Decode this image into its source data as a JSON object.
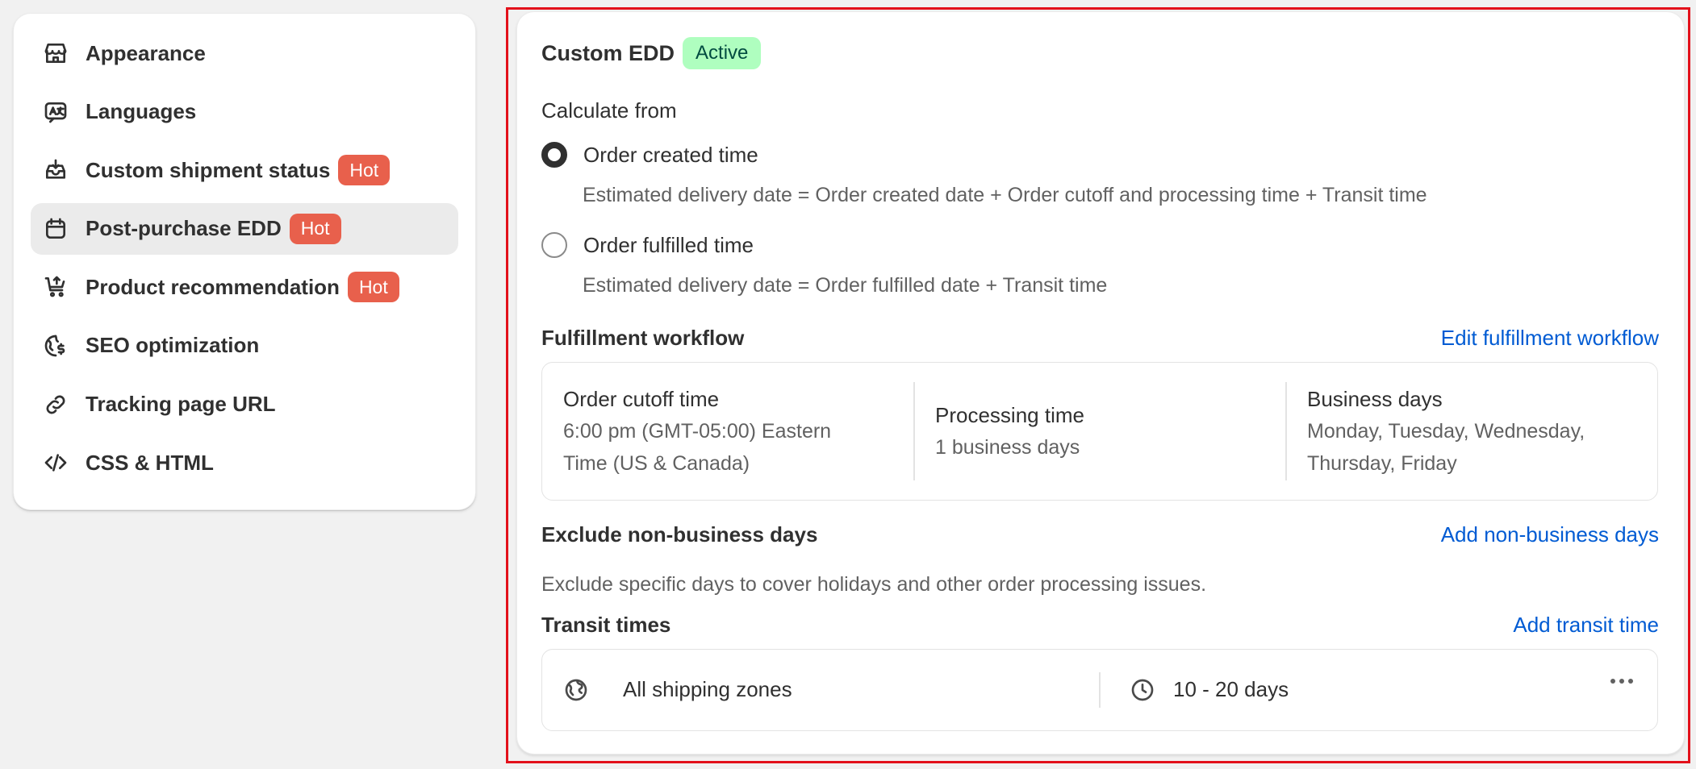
{
  "sidebar": {
    "items": [
      {
        "label": "Appearance",
        "icon": "store-icon",
        "hot": ""
      },
      {
        "label": "Languages",
        "icon": "translate-icon",
        "hot": ""
      },
      {
        "label": "Custom shipment status",
        "icon": "inbox-icon",
        "hot": "Hot"
      },
      {
        "label": "Post-purchase EDD",
        "icon": "calendar-icon",
        "hot": "Hot",
        "selected": true
      },
      {
        "label": "Product recommendation",
        "icon": "cart-icon",
        "hot": "Hot"
      },
      {
        "label": "SEO optimization",
        "icon": "globe-dollar-icon",
        "hot": ""
      },
      {
        "label": "Tracking page URL",
        "icon": "link-icon",
        "hot": ""
      },
      {
        "label": "CSS & HTML",
        "icon": "code-icon",
        "hot": ""
      }
    ]
  },
  "card": {
    "title": "Custom EDD",
    "status_badge": "Active",
    "calculate_from": {
      "label": "Calculate from",
      "options": [
        {
          "label": "Order created time",
          "helper": "Estimated delivery date = Order created date + Order cutoff and processing time + Transit time",
          "checked": true
        },
        {
          "label": "Order fulfilled time",
          "helper": "Estimated delivery date = Order fulfilled date + Transit time",
          "checked": false
        }
      ]
    },
    "workflow": {
      "label": "Fulfillment workflow",
      "link": "Edit fulfillment workflow",
      "cutoff": {
        "title": "Order cutoff time",
        "value_line1": "6:00 pm (GMT-05:00) Eastern",
        "value_line2": "Time (US & Canada)"
      },
      "processing": {
        "title": "Processing time",
        "value": "1 business days"
      },
      "business_days": {
        "title": "Business days",
        "value_line1": "Monday, Tuesday, Wednesday,",
        "value_line2": "Thursday, Friday"
      }
    },
    "exclude": {
      "label": "Exclude non-business days",
      "link": "Add non-business days",
      "description": "Exclude specific days to cover holidays and other order processing issues."
    },
    "transit": {
      "label": "Transit times",
      "link": "Add transit time",
      "zone": "All shipping zones",
      "duration": "10 - 20 days"
    }
  },
  "colors": {
    "hot_badge": "#e8604c",
    "active_badge_bg": "#affebf",
    "link": "#005bd3",
    "highlight_border": "#e3111b"
  }
}
